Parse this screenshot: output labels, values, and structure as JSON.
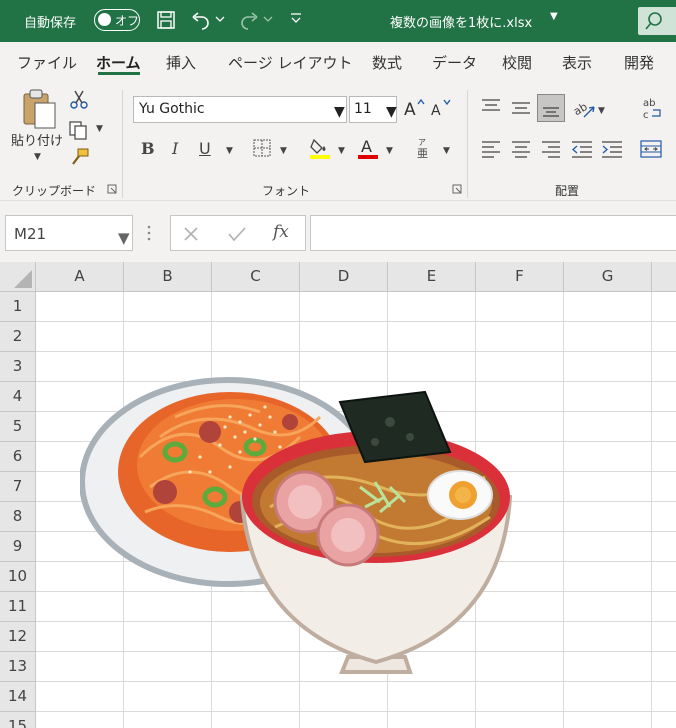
{
  "titlebar": {
    "autosave_label": "自動保存",
    "autosave_state": "オフ",
    "filename": "複数の画像を1枚に.xlsx"
  },
  "tabs": [
    "ファイル",
    "ホーム",
    "挿入",
    "ページ レイアウト",
    "数式",
    "データ",
    "校閲",
    "表示",
    "開発"
  ],
  "active_tab": "ホーム",
  "ribbon": {
    "paste_label": "貼り付け",
    "font_name": "Yu Gothic",
    "font_size": "11",
    "groups": {
      "clipboard": "クリップボード",
      "font": "フォント",
      "alignment": "配置"
    }
  },
  "formula_bar": {
    "name_box": "M21",
    "fx": "fx",
    "formula": ""
  },
  "grid": {
    "columns": [
      "A",
      "B",
      "C",
      "D",
      "E",
      "F",
      "G"
    ],
    "rows": [
      "1",
      "2",
      "3",
      "4",
      "5",
      "6",
      "7",
      "8",
      "9",
      "10",
      "11",
      "12",
      "13",
      "14",
      "15"
    ]
  },
  "picture": {
    "content": [
      "spaghetti-napolitan",
      "ramen"
    ]
  },
  "colors": {
    "excel_green": "#217346",
    "ribbon_bg": "#f3f2f1",
    "header_bg": "#e6e6e6",
    "gridline": "#dadada"
  }
}
